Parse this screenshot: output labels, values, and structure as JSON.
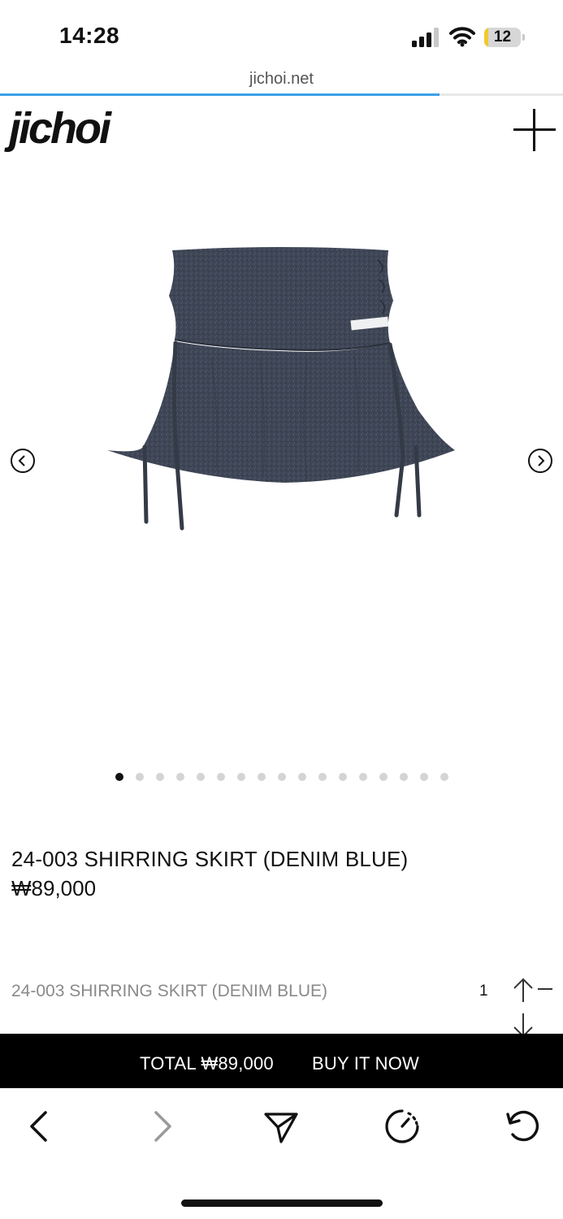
{
  "status": {
    "time": "14:28",
    "battery": "12",
    "battery_level": 0.12
  },
  "browser": {
    "url": "jichoi.net",
    "load_progress": 0.78
  },
  "site": {
    "logo": "jichoi"
  },
  "gallery": {
    "slide_count": 17,
    "active_index": 0
  },
  "product": {
    "title": "24-003 SHIRRING SKIRT (DENIM BLUE)",
    "price": "₩89,000"
  },
  "option": {
    "name": "24-003 SHIRRING SKIRT (DENIM BLUE)",
    "quantity": "1"
  },
  "buy_bar": {
    "total": "TOTAL ₩89,000",
    "buy_now": "BUY IT NOW"
  }
}
